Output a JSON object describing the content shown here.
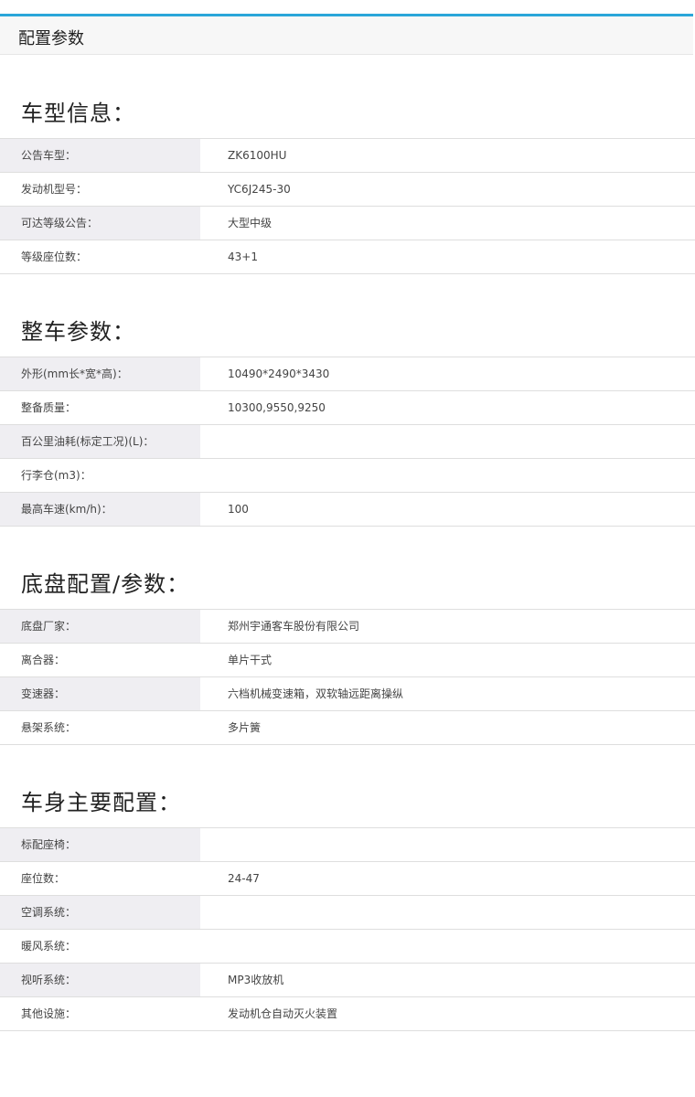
{
  "header": {
    "title": "配置参数"
  },
  "sections": [
    {
      "title": "车型信息：",
      "rows": [
        {
          "label": "公告车型：",
          "value": "ZK6100HU"
        },
        {
          "label": "发动机型号：",
          "value": "YC6J245-30"
        },
        {
          "label": "可达等级公告：",
          "value": "大型中级"
        },
        {
          "label": "等级座位数：",
          "value": "43+1"
        }
      ]
    },
    {
      "title": "整车参数：",
      "rows": [
        {
          "label": "外形(mm长*宽*高)：",
          "value": "10490*2490*3430"
        },
        {
          "label": "整备质量：",
          "value": "10300,9550,9250"
        },
        {
          "label": "百公里油耗(标定工况)(L)：",
          "value": ""
        },
        {
          "label": "行李仓(m3)：",
          "value": ""
        },
        {
          "label": "最高车速(km/h)：",
          "value": "100"
        }
      ]
    },
    {
      "title": "底盘配置/参数：",
      "rows": [
        {
          "label": "底盘厂家：",
          "value": "郑州宇通客车股份有限公司"
        },
        {
          "label": "离合器：",
          "value": "单片干式"
        },
        {
          "label": "变速器：",
          "value": "六档机械变速箱，双软轴远距离操纵"
        },
        {
          "label": "悬架系统：",
          "value": "多片簧"
        }
      ]
    },
    {
      "title": "车身主要配置：",
      "rows": [
        {
          "label": "标配座椅：",
          "value": ""
        },
        {
          "label": "座位数：",
          "value": "24-47"
        },
        {
          "label": "空调系统：",
          "value": ""
        },
        {
          "label": "暖风系统：",
          "value": ""
        },
        {
          "label": "视听系统：",
          "value": "MP3收放机"
        },
        {
          "label": "其他设施：",
          "value": "发动机仓自动灭火装置"
        }
      ]
    }
  ]
}
